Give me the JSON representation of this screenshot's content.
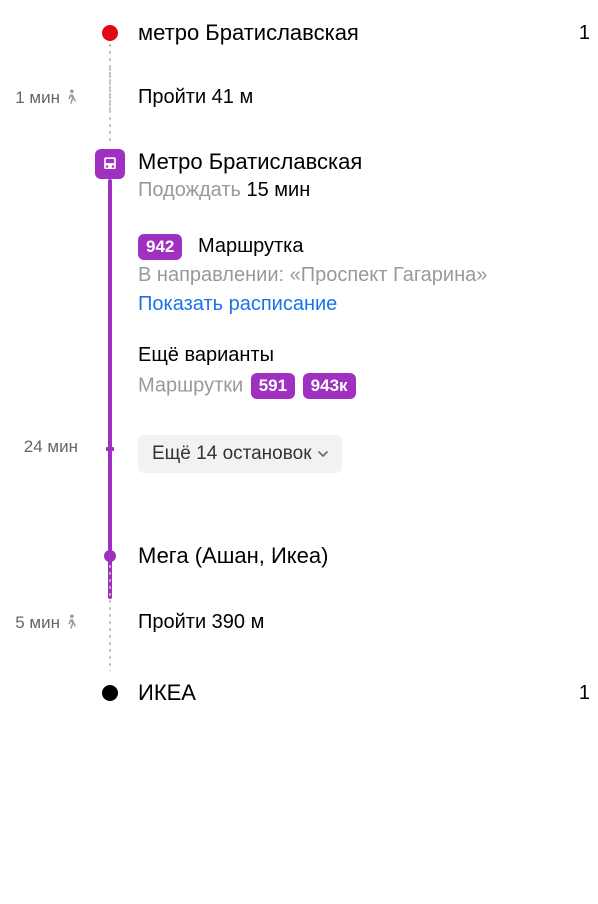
{
  "colors": {
    "metro_line": "#a030c0",
    "origin_dot": "#e30613",
    "link": "#1a73e8"
  },
  "origin": {
    "title": "метро Братиславская",
    "right_time": "1"
  },
  "walk1": {
    "duration": "1 мин",
    "text": "Пройти 41 м"
  },
  "board": {
    "station": "Метро Братиславская",
    "wait_prefix": "Подождать ",
    "wait_value": "15 мин",
    "route_badge": "942",
    "vehicle_type": "Маршрутка",
    "direction": "В направлении: «Проспект Гагарина»",
    "schedule": "Показать расписание",
    "alt_title": "Ещё варианты",
    "alt_label": "Маршрутки",
    "alt_badges": [
      "591",
      "943к"
    ]
  },
  "ride": {
    "duration": "24 мин",
    "stops_btn": "Ещё 14 остановок"
  },
  "alight": {
    "station": "Мега (Ашан, Икеа)"
  },
  "walk2": {
    "duration": "5 мин",
    "text": "Пройти 390 м"
  },
  "dest": {
    "title": "ИКЕА",
    "right_time": "1"
  }
}
